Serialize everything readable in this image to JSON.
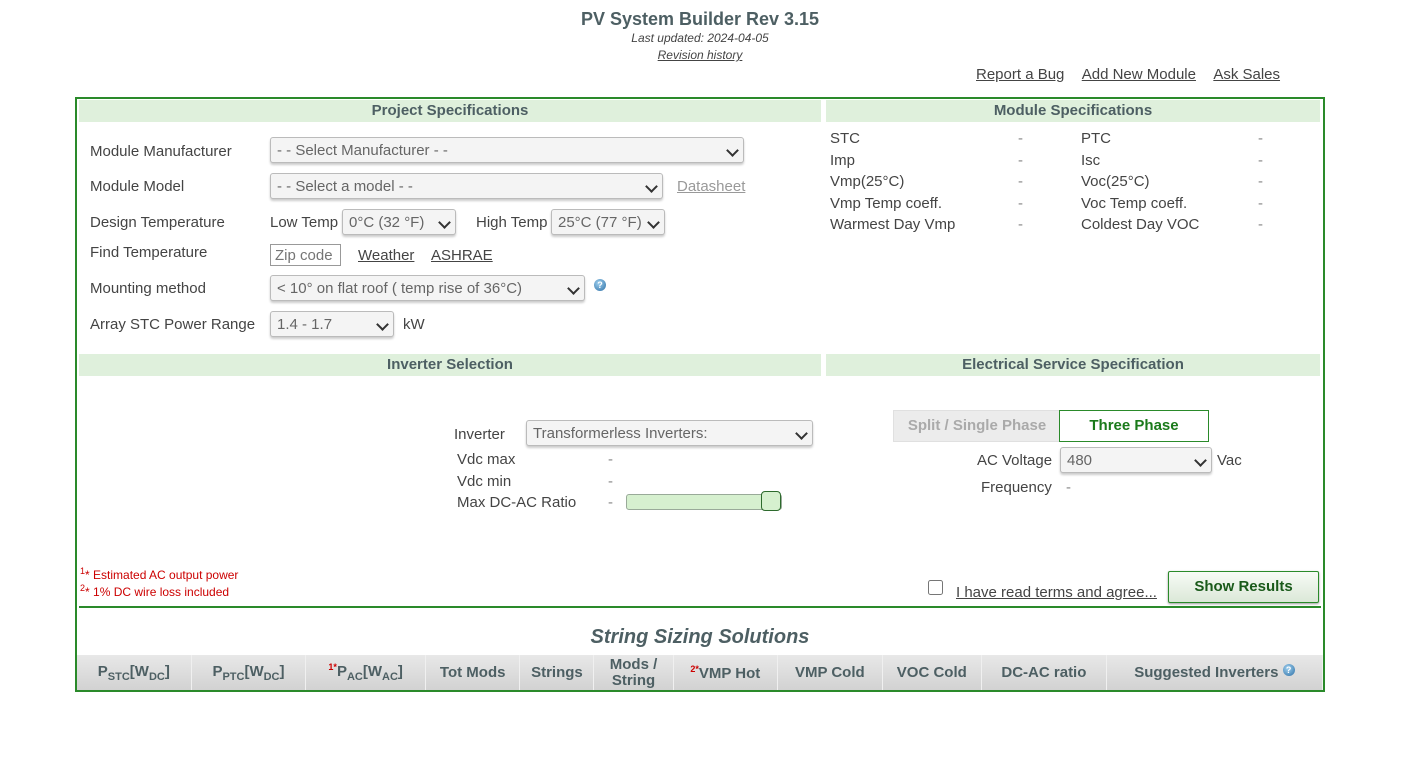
{
  "header": {
    "title": "PV System Builder Rev 3.15",
    "last_updated": "Last updated: 2024-04-05",
    "revision_history": "Revision history"
  },
  "toplinks": {
    "report_bug": "Report a Bug",
    "add_module": "Add New Module",
    "ask_sales": "Ask Sales"
  },
  "project": {
    "title": "Project Specifications",
    "manufacturer_label": "Module Manufacturer",
    "manufacturer_value": "- - Select Manufacturer - -",
    "model_label": "Module Model",
    "model_value": "- - Select a model - -",
    "datasheet": "Datasheet",
    "design_temp_label": "Design Temperature",
    "low_temp_label": "Low Temp",
    "low_temp_value": "0°C (32 °F)",
    "high_temp_label": "High Temp",
    "high_temp_value": "25°C (77 °F)",
    "find_temp_label": "Find Temperature",
    "zip_placeholder": "Zip code",
    "weather": "Weather",
    "ashrae": "ASHRAE",
    "mounting_label": "Mounting method",
    "mounting_value": "< 10° on flat roof ( temp rise of 36°C)",
    "power_range_label": "Array STC Power Range",
    "power_range_value": "1.4 - 1.7",
    "power_unit": "kW"
  },
  "module": {
    "title": "Module Specifications",
    "left": [
      {
        "label": "STC",
        "value": "-"
      },
      {
        "label": "Imp",
        "value": "-"
      },
      {
        "label": "Vmp(25°C)",
        "value": "-"
      },
      {
        "label": "Vmp Temp coeff.",
        "value": "-"
      },
      {
        "label": "Warmest Day Vmp",
        "value": "-"
      }
    ],
    "right": [
      {
        "label": "PTC",
        "value": "-"
      },
      {
        "label": "Isc",
        "value": "-"
      },
      {
        "label": "Voc(25°C)",
        "value": "-"
      },
      {
        "label": "Voc Temp coeff.",
        "value": "-"
      },
      {
        "label": "Coldest Day VOC",
        "value": "-"
      }
    ]
  },
  "inverter": {
    "title": "Inverter Selection",
    "inverter_label": "Inverter",
    "inverter_value": "Transformerless Inverters:",
    "vdc_max_label": "Vdc max",
    "vdc_max_value": "-",
    "vdc_min_label": "Vdc min",
    "vdc_min_value": "-",
    "ratio_label": "Max DC-AC Ratio",
    "ratio_value": "-"
  },
  "electrical": {
    "title": "Electrical Service Specification",
    "split_phase": "Split / Single Phase",
    "three_phase": "Three Phase",
    "ac_voltage_label": "AC Voltage",
    "ac_voltage_value": "480",
    "ac_unit": "Vac",
    "frequency_label": "Frequency",
    "frequency_value": "-"
  },
  "notes": {
    "note1_mark": "1",
    "note1": "* Estimated AC output power",
    "note2_mark": "2",
    "note2": "* 1% DC wire loss included"
  },
  "terms": "I have read terms and agree...",
  "show_results": "Show Results",
  "results": {
    "title": "String Sizing Solutions",
    "cols": [
      "Tot Mods",
      "Strings",
      "VMP Cold",
      "VOC Cold",
      "DC-AC ratio",
      "Suggested Inverters"
    ],
    "mods_top": "Mods /",
    "mods_bottom": "String",
    "vmp_hot": "VMP Hot"
  }
}
